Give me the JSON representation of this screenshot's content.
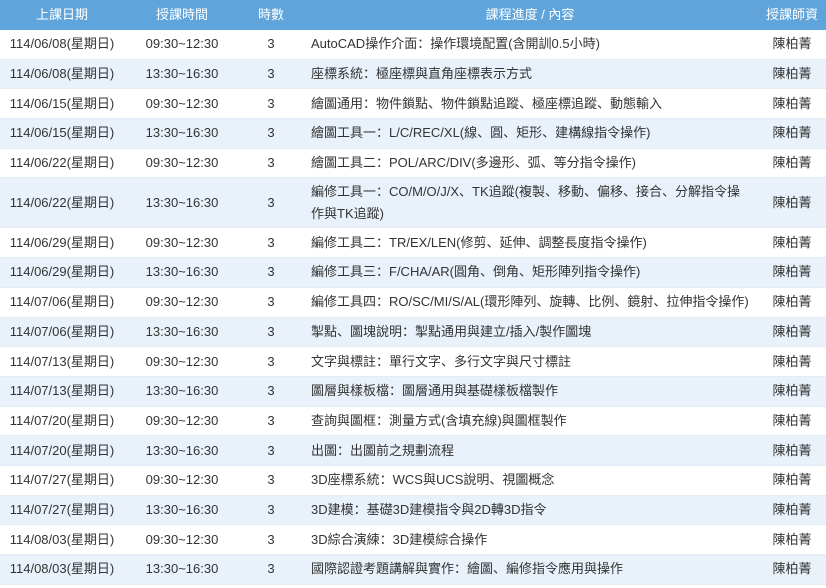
{
  "schedule": {
    "headers": {
      "date": "上課日期",
      "time": "授課時間",
      "hours": "時數",
      "content": "課程進度 / 內容",
      "instructor": "授課師資"
    },
    "rows": [
      {
        "date": "114/06/08(星期日)",
        "time": "09:30~12:30",
        "hours": "3",
        "content": "AutoCAD操作介面：操作環境配置(含開訓0.5小時)",
        "instructor": "陳柏菁"
      },
      {
        "date": "114/06/08(星期日)",
        "time": "13:30~16:30",
        "hours": "3",
        "content": "座標系統：極座標與直角座標表示方式",
        "instructor": "陳柏菁"
      },
      {
        "date": "114/06/15(星期日)",
        "time": "09:30~12:30",
        "hours": "3",
        "content": "繪圖通用：物件鎖點、物件鎖點追蹤、極座標追蹤、動態輸入",
        "instructor": "陳柏菁"
      },
      {
        "date": "114/06/15(星期日)",
        "time": "13:30~16:30",
        "hours": "3",
        "content": "繪圖工具一：L/C/REC/XL(線、圓、矩形、建構線指令操作)",
        "instructor": "陳柏菁"
      },
      {
        "date": "114/06/22(星期日)",
        "time": "09:30~12:30",
        "hours": "3",
        "content": "繪圖工具二：POL/ARC/DIV(多邊形、弧、等分指令操作)",
        "instructor": "陳柏菁"
      },
      {
        "date": "114/06/22(星期日)",
        "time": "13:30~16:30",
        "hours": "3",
        "content": "編修工具一：CO/M/O/J/X、TK追蹤(複製、移動、偏移、接合、分解指令操作與TK追蹤)",
        "instructor": "陳柏菁"
      },
      {
        "date": "114/06/29(星期日)",
        "time": "09:30~12:30",
        "hours": "3",
        "content": "編修工具二：TR/EX/LEN(修剪、延伸、調整長度指令操作)",
        "instructor": "陳柏菁"
      },
      {
        "date": "114/06/29(星期日)",
        "time": "13:30~16:30",
        "hours": "3",
        "content": "編修工具三：F/CHA/AR(圓角、倒角、矩形陣列指令操作)",
        "instructor": "陳柏菁"
      },
      {
        "date": "114/07/06(星期日)",
        "time": "09:30~12:30",
        "hours": "3",
        "content": "編修工具四：RO/SC/MI/S/AL(環形陣列、旋轉、比例、鏡射、拉伸指令操作)",
        "instructor": "陳柏菁"
      },
      {
        "date": "114/07/06(星期日)",
        "time": "13:30~16:30",
        "hours": "3",
        "content": "掣點、圖塊說明：掣點通用與建立/插入/製作圖塊",
        "instructor": "陳柏菁"
      },
      {
        "date": "114/07/13(星期日)",
        "time": "09:30~12:30",
        "hours": "3",
        "content": "文字與標註：單行文字、多行文字與尺寸標註",
        "instructor": "陳柏菁"
      },
      {
        "date": "114/07/13(星期日)",
        "time": "13:30~16:30",
        "hours": "3",
        "content": "圖層與樣板檔：圖層通用與基礎樣板檔製作",
        "instructor": "陳柏菁"
      },
      {
        "date": "114/07/20(星期日)",
        "time": "09:30~12:30",
        "hours": "3",
        "content": "查詢與圖框：測量方式(含填充線)與圖框製作",
        "instructor": "陳柏菁"
      },
      {
        "date": "114/07/20(星期日)",
        "time": "13:30~16:30",
        "hours": "3",
        "content": "出圖：出圖前之規劃流程",
        "instructor": "陳柏菁"
      },
      {
        "date": "114/07/27(星期日)",
        "time": "09:30~12:30",
        "hours": "3",
        "content": "3D座標系統：WCS與UCS說明、視圖概念",
        "instructor": "陳柏菁"
      },
      {
        "date": "114/07/27(星期日)",
        "time": "13:30~16:30",
        "hours": "3",
        "content": "3D建模：基礎3D建模指令與2D轉3D指令",
        "instructor": "陳柏菁"
      },
      {
        "date": "114/08/03(星期日)",
        "time": "09:30~12:30",
        "hours": "3",
        "content": "3D綜合演練：3D建模綜合操作",
        "instructor": "陳柏菁"
      },
      {
        "date": "114/08/03(星期日)",
        "time": "13:30~16:30",
        "hours": "3",
        "content": "國際認證考題講解與實作：繪圖、編修指令應用與操作",
        "instructor": "陳柏菁"
      }
    ]
  },
  "colors": {
    "header_bg": "#5fa5dc",
    "header_text": "#ffffff",
    "row_alt_bg": "#e9f2fb",
    "text": "#333333"
  }
}
